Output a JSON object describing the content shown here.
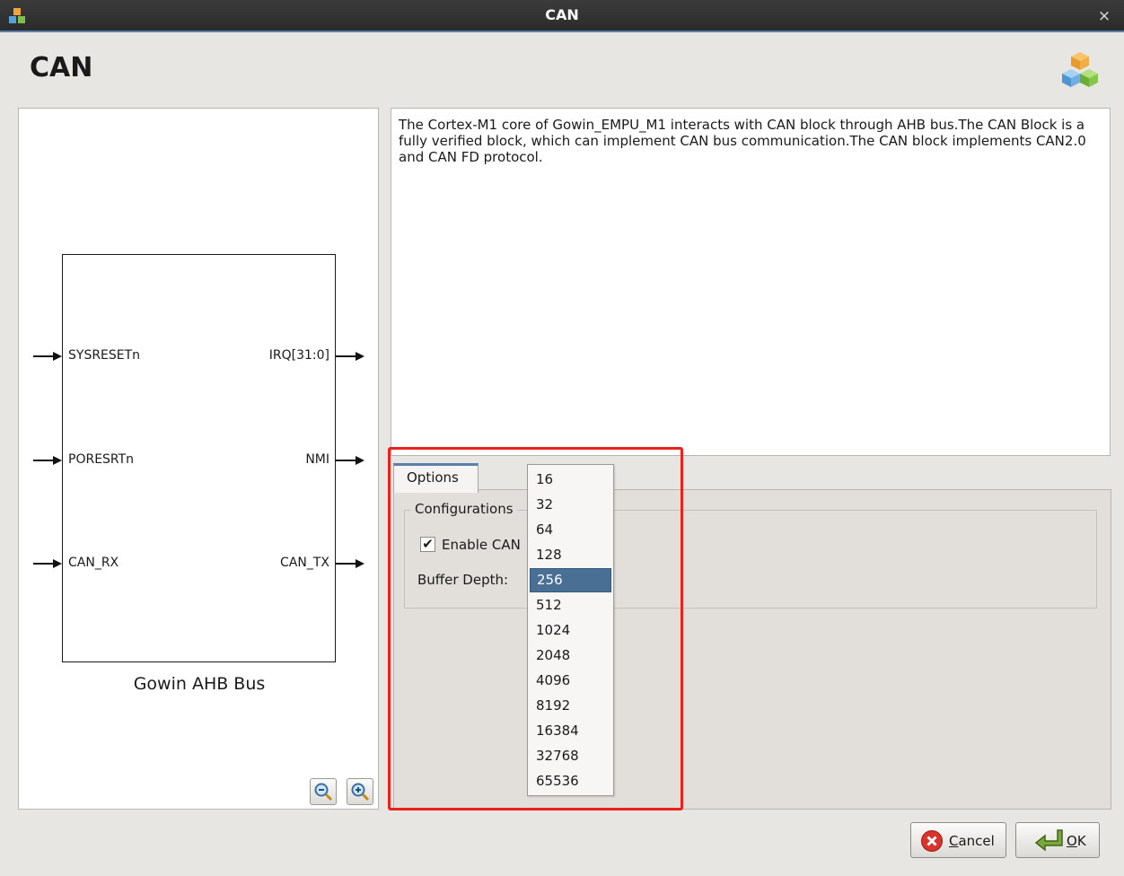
{
  "window": {
    "title": "CAN",
    "close_glyph": "×",
    "app_icon": "cubes-icon"
  },
  "page": {
    "heading": "CAN",
    "logo_icon": "cubes-icon"
  },
  "diagram": {
    "ports_left": [
      "SYSRESETn",
      "PORESRTn",
      "CAN_RX"
    ],
    "ports_right": [
      "IRQ[31:0]",
      "NMI",
      "CAN_TX"
    ],
    "bus_label": "Gowin AHB Bus",
    "zoom_out_icon": "zoom-out-icon",
    "zoom_in_icon": "zoom-in-icon"
  },
  "description": "The Cortex-M1 core of Gowin_EMPU_M1 interacts with CAN block through AHB bus.The CAN Block is a fully verified block, which can implement CAN bus communication.The CAN block implements CAN2.0 and CAN FD protocol.",
  "options": {
    "tab_label": "Options",
    "group_title": "Configurations",
    "enable_label": "Enable CAN",
    "enable_checked": true,
    "check_glyph": "✔",
    "buffer_label": "Buffer Depth:",
    "buffer_options": [
      "16",
      "32",
      "64",
      "128",
      "256",
      "512",
      "1024",
      "2048",
      "4096",
      "8192",
      "16384",
      "32768",
      "65536"
    ],
    "buffer_selected": "256"
  },
  "buttons": {
    "cancel": {
      "mnemonic": "C",
      "rest": "ancel",
      "icon": "cancel-icon"
    },
    "ok": {
      "mnemonic": "O",
      "rest": "K",
      "icon": "ok-arrow-icon"
    }
  },
  "colors": {
    "accent": "#5b7fa8",
    "highlight": "#e8231d",
    "selection": "#4a6f94"
  }
}
